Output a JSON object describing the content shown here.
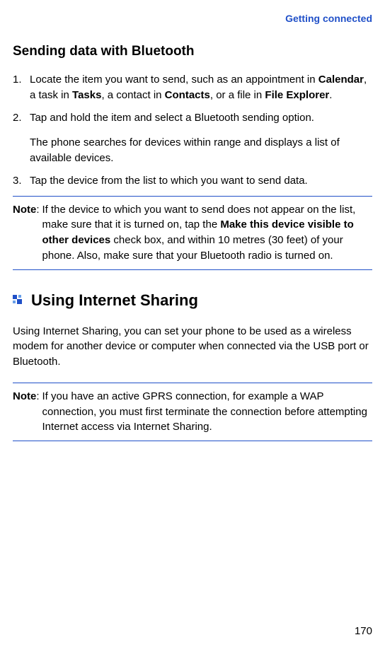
{
  "header": {
    "breadcrumb": "Getting connected"
  },
  "section1": {
    "title": "Sending data with Bluetooth",
    "steps": [
      {
        "pre": "Locate the item you want to send, such as an appointment in ",
        "b1": "Calendar",
        "mid1": ", a task in ",
        "b2": "Tasks",
        "mid2": ", a contact in ",
        "b3": "Contacts",
        "mid3": ", or a file in ",
        "b4": "File Explorer",
        "post": "."
      },
      {
        "text": "Tap and hold the item and select a Bluetooth sending option.",
        "sub": "The phone searches for devices within range and displays a list of available devices."
      },
      {
        "text": "Tap the device from the list to which you want to send data."
      }
    ],
    "note": {
      "label": "Note",
      "pre": "If the device to which you want to send does not appear on the list, make sure that it is turned on, tap the ",
      "bold": "Make this device visible to other devices",
      "post": " check box, and within 10 metres (30 feet) of your phone. Also, make sure that your Bluetooth radio is turned on."
    }
  },
  "section2": {
    "title": "Using Internet Sharing",
    "para": "Using Internet Sharing, you can set your phone to be used as a wireless modem for another device or computer when connected via the USB port or Bluetooth.",
    "note": {
      "label": "Note",
      "text": "If you have an active GPRS connection, for example a WAP connection, you must first terminate the connection before attempting Internet access via Internet Sharing."
    }
  },
  "page": "170"
}
